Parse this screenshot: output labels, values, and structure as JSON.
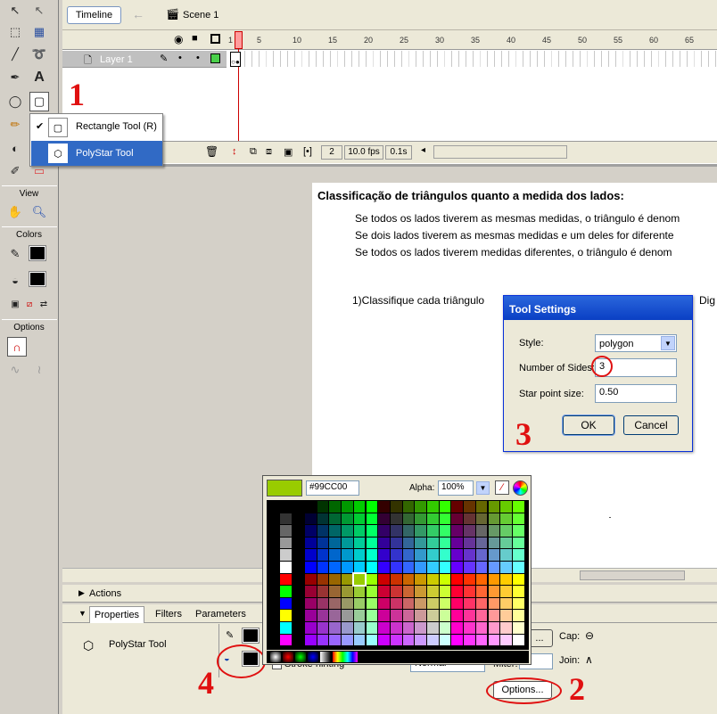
{
  "timeline": {
    "tab": "Timeline",
    "scene": "Scene 1",
    "layer": "Layer 1",
    "frame_numbers": [
      "1",
      "5",
      "10",
      "15",
      "20",
      "25",
      "30",
      "35",
      "40",
      "45",
      "50",
      "55",
      "60",
      "65"
    ],
    "current_frame": "2",
    "fps": "10.0 fps",
    "time": "0.1s"
  },
  "toolbar": {
    "view_label": "View",
    "colors_label": "Colors",
    "options_label": "Options"
  },
  "flyout": {
    "items": [
      {
        "label": "Rectangle Tool (R)",
        "checked": true
      },
      {
        "label": "PolyStar Tool",
        "selected": true
      }
    ]
  },
  "document": {
    "title": "Classificação de triângulos quanto a medida dos lados:",
    "lines": [
      "Se todos os lados tiverem as mesmas medidas, o triângulo é denom",
      "Se dois lados tiverem as mesmas medidas e um deles for diferente",
      "Se todos os lados tiverem medidas diferentes, o triângulo é denom"
    ],
    "question": "1)Classifique cada triângulo",
    "question_right": "Dig"
  },
  "tool_settings": {
    "title": "Tool Settings",
    "style_label": "Style:",
    "style_value": "polygon",
    "sides_label": "Number of Sides:",
    "sides_value": "3",
    "star_label": "Star point size:",
    "star_value": "0.50",
    "ok": "OK",
    "cancel": "Cancel"
  },
  "color_picker": {
    "hex": "#99CC00",
    "alpha_label": "Alpha:",
    "alpha_value": "100%",
    "preview_color": "#99CC00"
  },
  "panels": {
    "actions": "Actions",
    "tabs": [
      "Properties",
      "Filters",
      "Parameters"
    ],
    "tool_name": "PolyStar Tool",
    "cap_label": "Cap:",
    "join_label": "Join:",
    "options_button": "Options...",
    "stroke_hinting": "Stroke hinting",
    "scale_value": "Normal",
    "miter_label": "Miter:"
  },
  "annotations": [
    "1",
    "2",
    "3",
    "4"
  ]
}
